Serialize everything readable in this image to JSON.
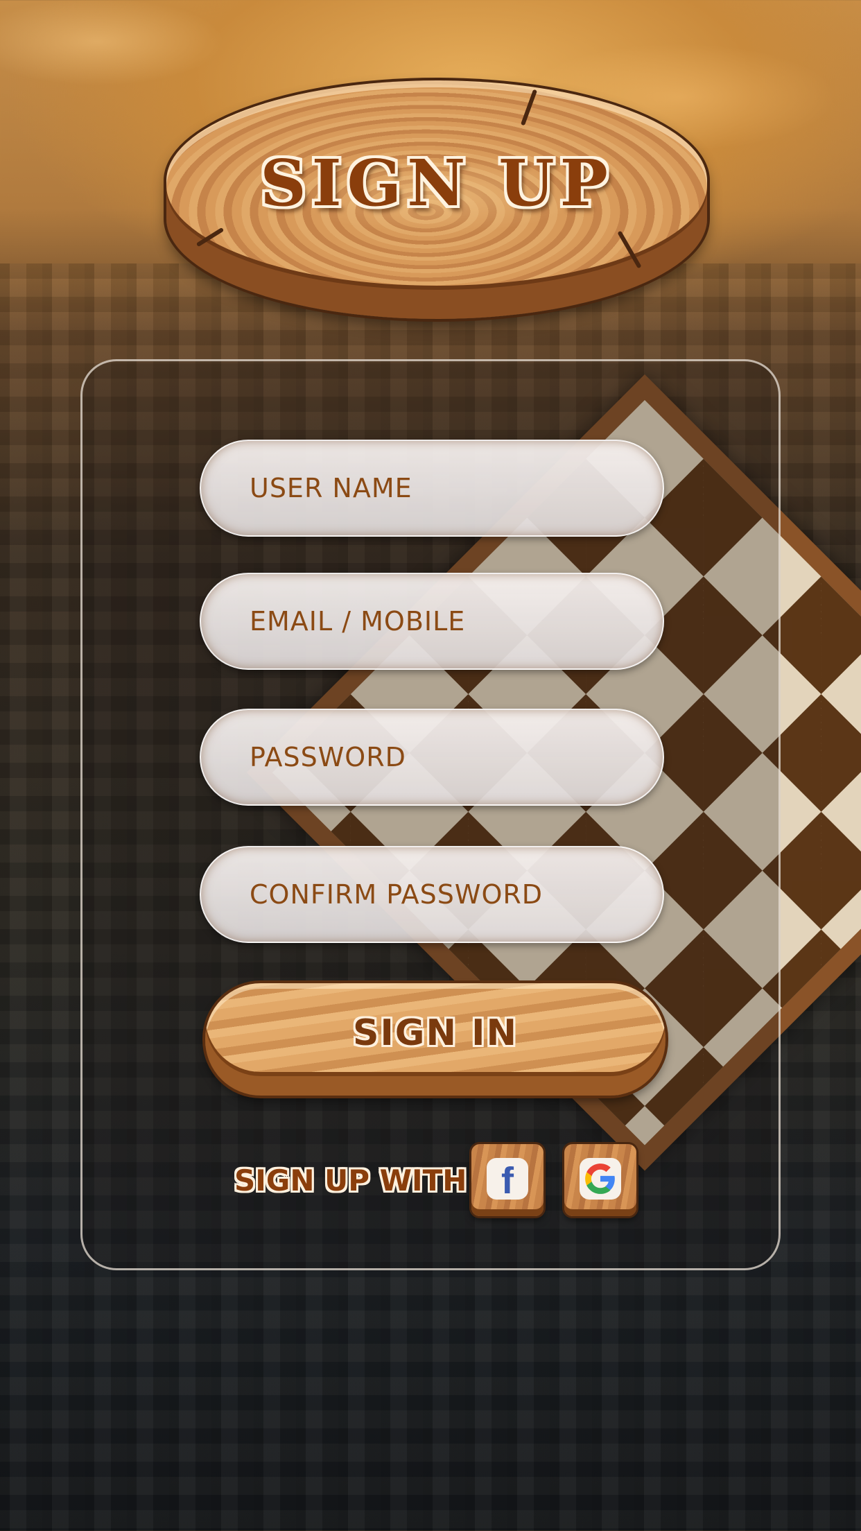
{
  "header": {
    "title": "SIGN UP"
  },
  "form": {
    "fields": [
      {
        "placeholder": "USER NAME"
      },
      {
        "placeholder": "EMAIL / MOBILE"
      },
      {
        "placeholder": "PASSWORD"
      },
      {
        "placeholder": "CONFIRM PASSWORD"
      }
    ],
    "submit_label": "SIGN IN"
  },
  "social": {
    "label": "SIGN UP WITH",
    "providers": [
      {
        "icon": "facebook-icon"
      },
      {
        "icon": "google-icon"
      }
    ]
  },
  "colors": {
    "text_brown": "#8b4a14",
    "wood": "#c8884a",
    "field_bg": "#efeae8"
  }
}
